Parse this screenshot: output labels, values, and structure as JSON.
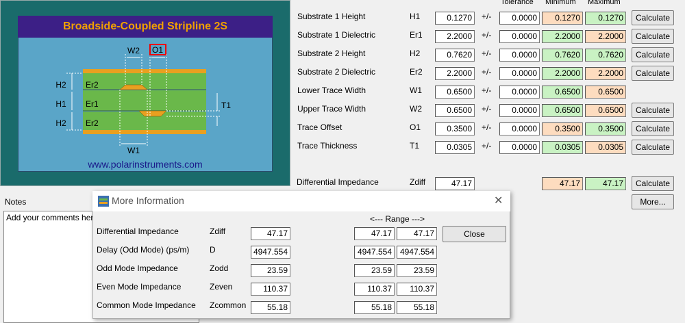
{
  "diagram": {
    "title": "Broadside-Coupled Stripline 2S",
    "url": "www.polarinstruments.com",
    "labels": {
      "w2": "W2",
      "o1": "O1",
      "w1": "W1",
      "h2_top": "H2",
      "h1": "H1",
      "h2_bottom": "H2",
      "er2_top": "Er2",
      "er1": "Er1",
      "er2_bottom": "Er2",
      "t1": "T1"
    }
  },
  "headers": {
    "tolerance": "Tolerance",
    "minimum": "Minimum",
    "maximum": "Maximum"
  },
  "rows": [
    {
      "label": "Substrate 1 Height",
      "sym": "H1",
      "value": "0.1270",
      "pm": "+/-",
      "tol": "0.0000",
      "min": "0.1270",
      "max": "0.1270",
      "min_color": "orange",
      "max_color": "green",
      "button": "Calculate"
    },
    {
      "label": "Substrate 1 Dielectric",
      "sym": "Er1",
      "value": "2.2000",
      "pm": "+/-",
      "tol": "0.0000",
      "min": "2.2000",
      "max": "2.2000",
      "min_color": "green",
      "max_color": "orange",
      "button": "Calculate"
    },
    {
      "label": "Substrate 2 Height",
      "sym": "H2",
      "value": "0.7620",
      "pm": "+/-",
      "tol": "0.0000",
      "min": "0.7620",
      "max": "0.7620",
      "min_color": "green",
      "max_color": "green",
      "button": "Calculate"
    },
    {
      "label": "Substrate 2 Dielectric",
      "sym": "Er2",
      "value": "2.2000",
      "pm": "+/-",
      "tol": "0.0000",
      "min": "2.2000",
      "max": "2.2000",
      "min_color": "green",
      "max_color": "orange",
      "button": "Calculate"
    },
    {
      "label": "Lower Trace Width",
      "sym": "W1",
      "value": "0.6500",
      "pm": "+/-",
      "tol": "0.0000",
      "min": "0.6500",
      "max": "0.6500",
      "min_color": "green",
      "max_color": "orange",
      "button": ""
    },
    {
      "label": "Upper Trace Width",
      "sym": "W2",
      "value": "0.6500",
      "pm": "+/-",
      "tol": "0.0000",
      "min": "0.6500",
      "max": "0.6500",
      "min_color": "green",
      "max_color": "orange",
      "button": "Calculate"
    },
    {
      "label": "Trace Offset",
      "sym": "O1",
      "value": "0.3500",
      "pm": "+/-",
      "tol": "0.0000",
      "min": "0.3500",
      "max": "0.3500",
      "min_color": "orange",
      "max_color": "green",
      "button": "Calculate"
    },
    {
      "label": "Trace Thickness",
      "sym": "T1",
      "value": "0.0305",
      "pm": "+/-",
      "tol": "0.0000",
      "min": "0.0305",
      "max": "0.0305",
      "min_color": "green",
      "max_color": "orange",
      "button": "Calculate"
    }
  ],
  "diff_impedance": {
    "label": "Differential Impedance",
    "sym": "Zdiff",
    "value": "47.17",
    "min": "47.17",
    "max": "47.17",
    "button": "Calculate"
  },
  "more_button": "More...",
  "notes": {
    "label": "Notes",
    "text": "Add your comments here"
  },
  "dialog": {
    "title": "More Information",
    "range_header": "<--- Range --->",
    "close_button": "Close",
    "rows": [
      {
        "label": "Differential Impedance",
        "sym": "Zdiff",
        "value": "47.17",
        "min": "47.17",
        "max": "47.17"
      },
      {
        "label": "Delay (Odd Mode) (ps/m)",
        "sym": "D",
        "value": "4947.554",
        "min": "4947.554",
        "max": "4947.554"
      },
      {
        "label": "Odd Mode Impedance",
        "sym": "Zodd",
        "value": "23.59",
        "min": "23.59",
        "max": "23.59"
      },
      {
        "label": "Even Mode Impedance",
        "sym": "Zeven",
        "value": "110.37",
        "min": "110.37",
        "max": "110.37"
      },
      {
        "label": "Common Mode Impedance",
        "sym": "Zcommon",
        "value": "55.18",
        "min": "55.18",
        "max": "55.18"
      }
    ]
  },
  "colors": {
    "orange": "#fddcbf",
    "green": "#c9f2c3",
    "title_bg": "#3c1f86",
    "title_fg": "#f0a000",
    "teal": "#1a6b6b"
  }
}
